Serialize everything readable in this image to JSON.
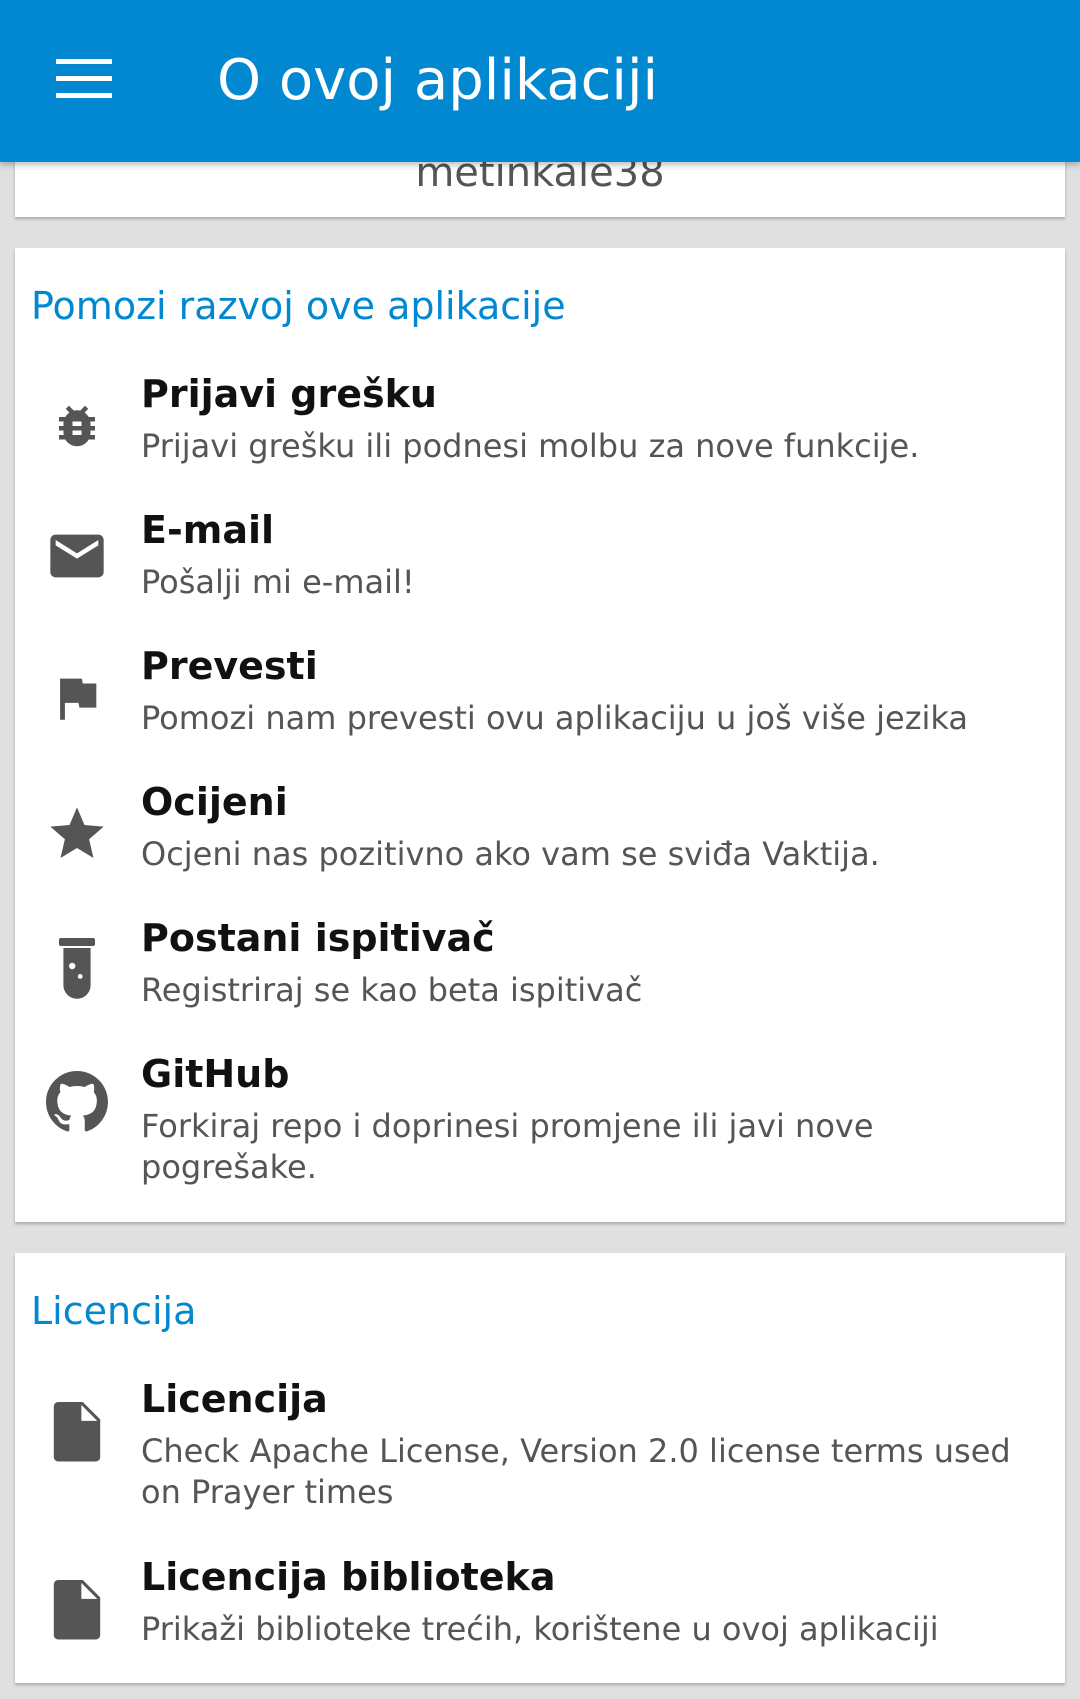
{
  "toolbar": {
    "title": "O ovoj aplikaciji",
    "menu_icon": "hamburger-menu-icon"
  },
  "author": {
    "name": "metinkale38"
  },
  "help_section": {
    "title": "Pomozi razvoj ove aplikacije",
    "items": [
      {
        "icon": "bug-icon",
        "title": "Prijavi grešku",
        "desc": "Prijavi grešku ili podnesi molbu za nove funkcije."
      },
      {
        "icon": "email-icon",
        "title": "E-mail",
        "desc": "Pošalji mi e-mail!"
      },
      {
        "icon": "flag-icon",
        "title": "Prevesti",
        "desc": "Pomozi nam prevesti ovu aplikaciju u još više jezika"
      },
      {
        "icon": "star-icon",
        "title": "Ocijeni",
        "desc": "Ocjeni nas pozitivno ako vam se sviđa Vaktija."
      },
      {
        "icon": "test-tube-icon",
        "title": "Postani ispitivač",
        "desc": "Registriraj se kao beta ispitivač"
      },
      {
        "icon": "github-icon",
        "title": "GitHub",
        "desc": "Forkiraj repo i doprinesi promjene ili javi nove pogrešake."
      }
    ]
  },
  "license_section": {
    "title": "Licencija",
    "items": [
      {
        "icon": "file-icon",
        "title": "Licencija",
        "desc": "Check Apache License, Version 2.0 license terms used on Prayer times"
      },
      {
        "icon": "file-icon",
        "title": "Licencija biblioteka",
        "desc": "Prikaži biblioteke trećih, korištene u ovoj aplikaciji"
      }
    ]
  },
  "colors": {
    "primary": "#0288d1",
    "icon": "#555555",
    "background": "#e0e0e0"
  }
}
